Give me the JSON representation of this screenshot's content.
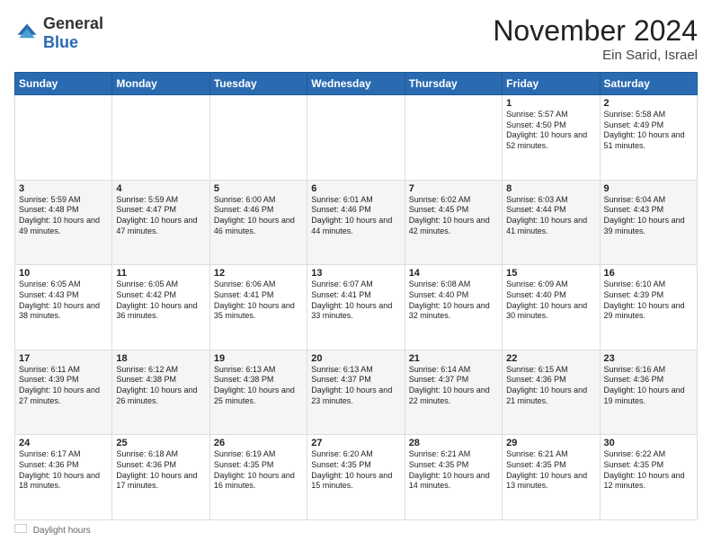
{
  "header": {
    "logo_general": "General",
    "logo_blue": "Blue",
    "month_title": "November 2024",
    "location": "Ein Sarid, Israel"
  },
  "days_of_week": [
    "Sunday",
    "Monday",
    "Tuesday",
    "Wednesday",
    "Thursday",
    "Friday",
    "Saturday"
  ],
  "weeks": [
    [
      {
        "day": "",
        "info": ""
      },
      {
        "day": "",
        "info": ""
      },
      {
        "day": "",
        "info": ""
      },
      {
        "day": "",
        "info": ""
      },
      {
        "day": "",
        "info": ""
      },
      {
        "day": "1",
        "info": "Sunrise: 5:57 AM\nSunset: 4:50 PM\nDaylight: 10 hours and 52 minutes."
      },
      {
        "day": "2",
        "info": "Sunrise: 5:58 AM\nSunset: 4:49 PM\nDaylight: 10 hours and 51 minutes."
      }
    ],
    [
      {
        "day": "3",
        "info": "Sunrise: 5:59 AM\nSunset: 4:48 PM\nDaylight: 10 hours and 49 minutes."
      },
      {
        "day": "4",
        "info": "Sunrise: 5:59 AM\nSunset: 4:47 PM\nDaylight: 10 hours and 47 minutes."
      },
      {
        "day": "5",
        "info": "Sunrise: 6:00 AM\nSunset: 4:46 PM\nDaylight: 10 hours and 46 minutes."
      },
      {
        "day": "6",
        "info": "Sunrise: 6:01 AM\nSunset: 4:46 PM\nDaylight: 10 hours and 44 minutes."
      },
      {
        "day": "7",
        "info": "Sunrise: 6:02 AM\nSunset: 4:45 PM\nDaylight: 10 hours and 42 minutes."
      },
      {
        "day": "8",
        "info": "Sunrise: 6:03 AM\nSunset: 4:44 PM\nDaylight: 10 hours and 41 minutes."
      },
      {
        "day": "9",
        "info": "Sunrise: 6:04 AM\nSunset: 4:43 PM\nDaylight: 10 hours and 39 minutes."
      }
    ],
    [
      {
        "day": "10",
        "info": "Sunrise: 6:05 AM\nSunset: 4:43 PM\nDaylight: 10 hours and 38 minutes."
      },
      {
        "day": "11",
        "info": "Sunrise: 6:05 AM\nSunset: 4:42 PM\nDaylight: 10 hours and 36 minutes."
      },
      {
        "day": "12",
        "info": "Sunrise: 6:06 AM\nSunset: 4:41 PM\nDaylight: 10 hours and 35 minutes."
      },
      {
        "day": "13",
        "info": "Sunrise: 6:07 AM\nSunset: 4:41 PM\nDaylight: 10 hours and 33 minutes."
      },
      {
        "day": "14",
        "info": "Sunrise: 6:08 AM\nSunset: 4:40 PM\nDaylight: 10 hours and 32 minutes."
      },
      {
        "day": "15",
        "info": "Sunrise: 6:09 AM\nSunset: 4:40 PM\nDaylight: 10 hours and 30 minutes."
      },
      {
        "day": "16",
        "info": "Sunrise: 6:10 AM\nSunset: 4:39 PM\nDaylight: 10 hours and 29 minutes."
      }
    ],
    [
      {
        "day": "17",
        "info": "Sunrise: 6:11 AM\nSunset: 4:39 PM\nDaylight: 10 hours and 27 minutes."
      },
      {
        "day": "18",
        "info": "Sunrise: 6:12 AM\nSunset: 4:38 PM\nDaylight: 10 hours and 26 minutes."
      },
      {
        "day": "19",
        "info": "Sunrise: 6:13 AM\nSunset: 4:38 PM\nDaylight: 10 hours and 25 minutes."
      },
      {
        "day": "20",
        "info": "Sunrise: 6:13 AM\nSunset: 4:37 PM\nDaylight: 10 hours and 23 minutes."
      },
      {
        "day": "21",
        "info": "Sunrise: 6:14 AM\nSunset: 4:37 PM\nDaylight: 10 hours and 22 minutes."
      },
      {
        "day": "22",
        "info": "Sunrise: 6:15 AM\nSunset: 4:36 PM\nDaylight: 10 hours and 21 minutes."
      },
      {
        "day": "23",
        "info": "Sunrise: 6:16 AM\nSunset: 4:36 PM\nDaylight: 10 hours and 19 minutes."
      }
    ],
    [
      {
        "day": "24",
        "info": "Sunrise: 6:17 AM\nSunset: 4:36 PM\nDaylight: 10 hours and 18 minutes."
      },
      {
        "day": "25",
        "info": "Sunrise: 6:18 AM\nSunset: 4:36 PM\nDaylight: 10 hours and 17 minutes."
      },
      {
        "day": "26",
        "info": "Sunrise: 6:19 AM\nSunset: 4:35 PM\nDaylight: 10 hours and 16 minutes."
      },
      {
        "day": "27",
        "info": "Sunrise: 6:20 AM\nSunset: 4:35 PM\nDaylight: 10 hours and 15 minutes."
      },
      {
        "day": "28",
        "info": "Sunrise: 6:21 AM\nSunset: 4:35 PM\nDaylight: 10 hours and 14 minutes."
      },
      {
        "day": "29",
        "info": "Sunrise: 6:21 AM\nSunset: 4:35 PM\nDaylight: 10 hours and 13 minutes."
      },
      {
        "day": "30",
        "info": "Sunrise: 6:22 AM\nSunset: 4:35 PM\nDaylight: 10 hours and 12 minutes."
      }
    ]
  ],
  "legend": {
    "daylight_hours_label": "Daylight hours"
  }
}
